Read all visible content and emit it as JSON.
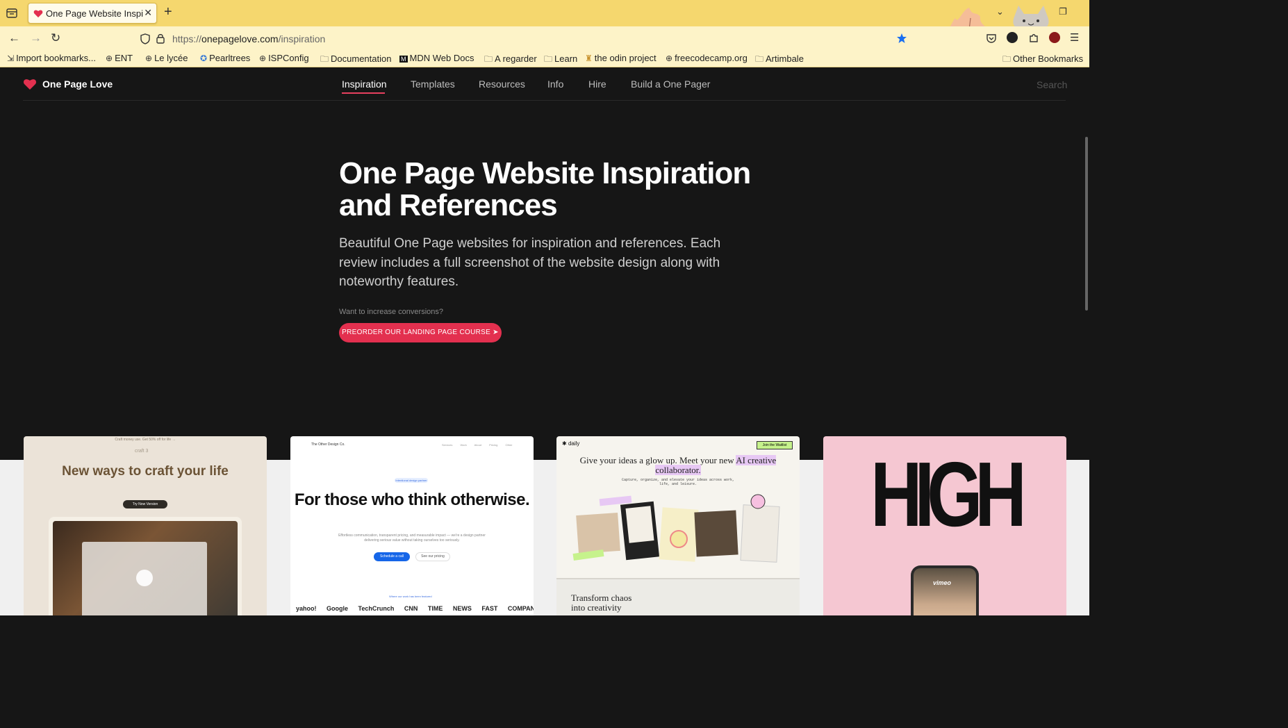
{
  "browser": {
    "tab_title": "One Page Website Inspira",
    "url_host": "onepagelove.com",
    "url_prefix": "https://",
    "url_path": "/inspiration",
    "bookmarks": [
      {
        "label": "Import bookmarks...",
        "icon": "import-icon"
      },
      {
        "label": "ENT",
        "icon": "globe-icon"
      },
      {
        "label": "Le lycée",
        "icon": "globe-icon"
      },
      {
        "label": "Pearltrees",
        "icon": "pearltrees-icon"
      },
      {
        "label": "ISPConfig",
        "icon": "globe-icon"
      },
      {
        "label": "Documentation",
        "icon": "folder-icon"
      },
      {
        "label": "MDN Web Docs",
        "icon": "mdn-icon"
      },
      {
        "label": "A regarder",
        "icon": "folder-icon"
      },
      {
        "label": "Learn",
        "icon": "folder-icon"
      },
      {
        "label": "the odin project",
        "icon": "odin-icon"
      },
      {
        "label": "freecodecamp.org",
        "icon": "globe-icon"
      },
      {
        "label": "Artimbale",
        "icon": "folder-icon"
      }
    ],
    "other_bookmarks": "Other Bookmarks",
    "accent": "#f5d76e"
  },
  "site": {
    "brand": "One Page Love",
    "nav": [
      "Inspiration",
      "Templates",
      "Resources",
      "Info",
      "Hire",
      "Build a One Pager"
    ],
    "active_nav": "Inspiration",
    "search_placeholder": "Search",
    "hero_title": "One Page Website Inspiration and References",
    "hero_subtitle": "Beautiful One Page websites for inspiration and references. Each review includes a full screenshot of the website design along with noteworthy features.",
    "cta_note": "Want to increase conversions?",
    "cta_label": "PREORDER OUR LANDING PAGE COURSE",
    "accent": "#e3304f"
  },
  "cards": {
    "craft": {
      "top": "Craft money use. Get 50% off for life →",
      "logo": "craft 3",
      "headline": "New ways to craft your life",
      "button": "Try Now Version"
    },
    "other_design": {
      "brand": "The Other Design Co.",
      "menu": "Services Work About Pricing Other",
      "badge": "Intentional design partner",
      "headline": "For those who think otherwise.",
      "paragraph": "Effortless communication, transparent pricing, and measurable impact — we're a design partner delivering serious value without taking ourselves too seriously.",
      "primary": "Schedule a call",
      "secondary": "See our pricing",
      "featured": "Where our work has been featured",
      "logos": "yahoo! Google TechCrunch CNN TIME NEWS FAST COMPANY"
    },
    "daily": {
      "logo": "daily",
      "button": "Join the Waitlist",
      "headline_1": "Give your ideas a glow up. Meet your new ",
      "headline_hl": "AI creative collaborator.",
      "paragraph": "Capture, organize, and elevate your ideas across work, life, and leisure.",
      "bottom": "Transform chaos into creativity"
    },
    "high": {
      "word": "HIGH",
      "phone_brand": "vimeo"
    }
  }
}
